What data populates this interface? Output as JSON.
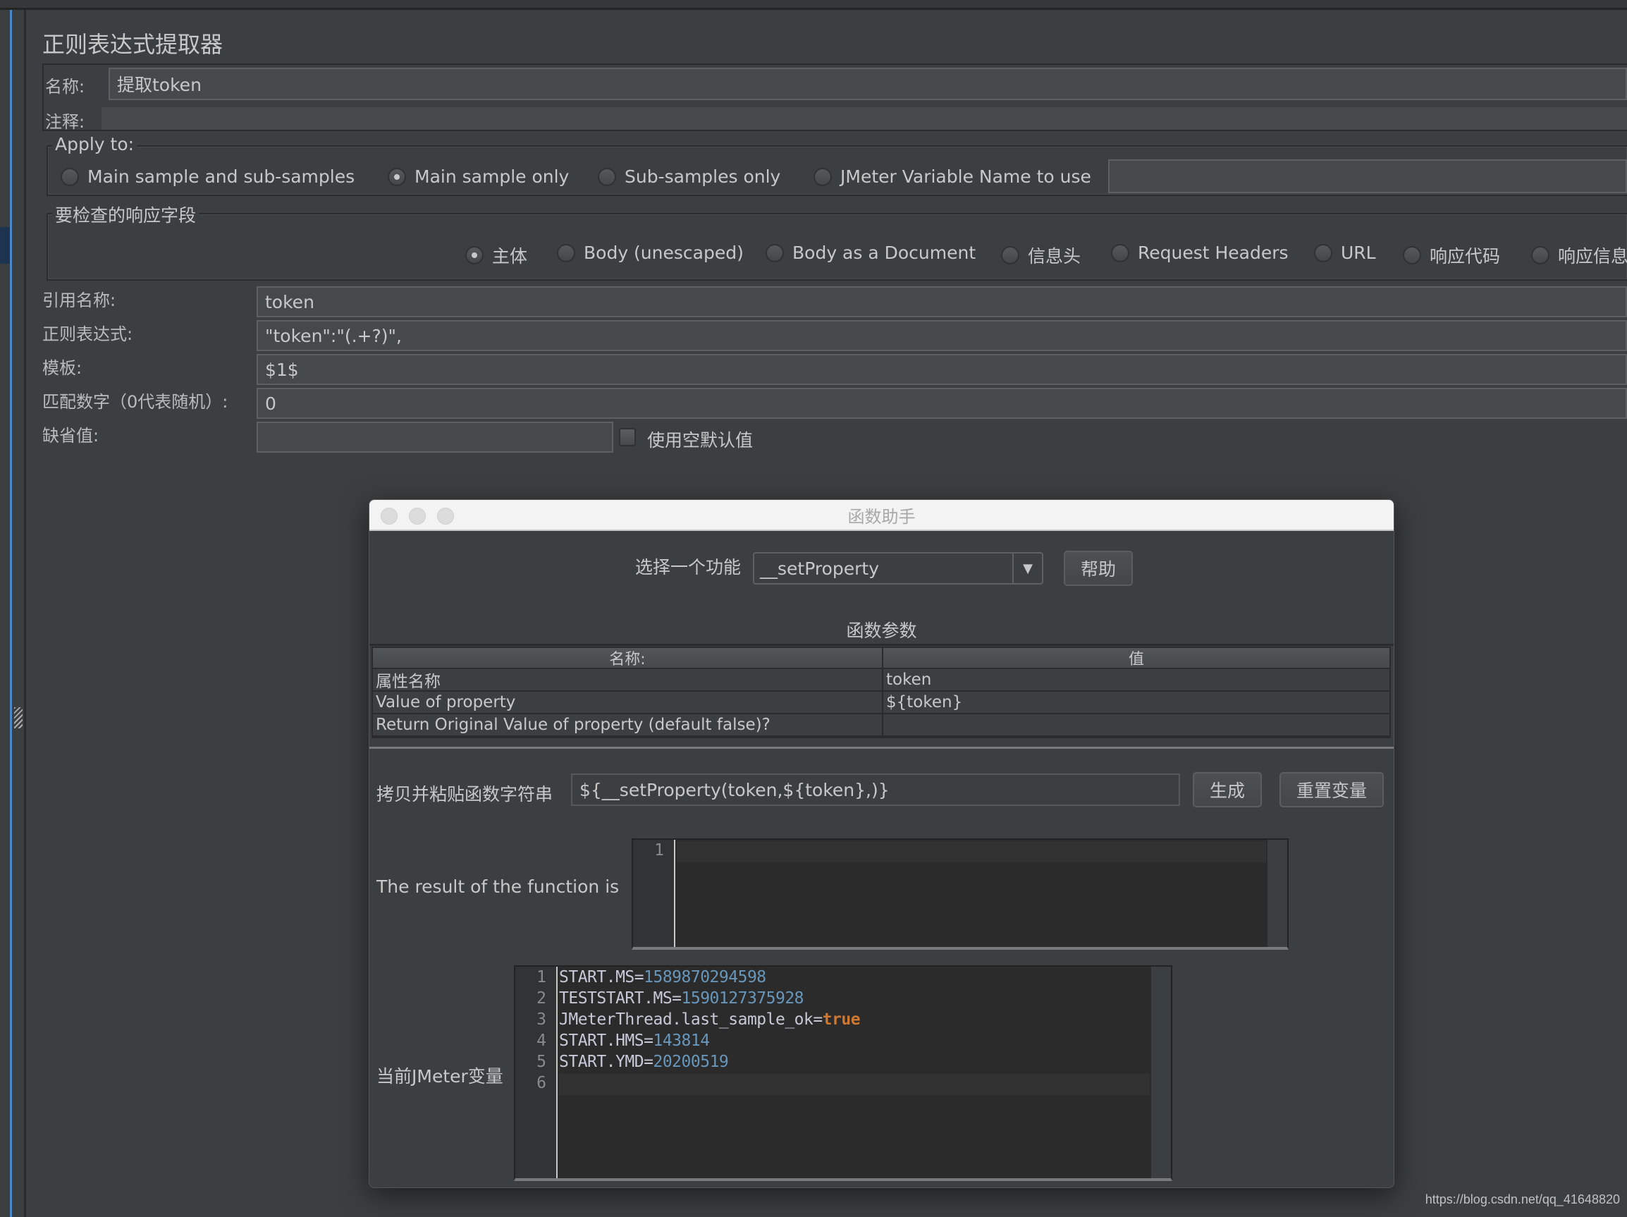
{
  "panel": {
    "title": "正则表达式提取器",
    "name_label": "名称:",
    "name_value": "提取token",
    "comment_label": "注释:",
    "comment_value": ""
  },
  "apply_to": {
    "legend": "Apply to:",
    "options": [
      {
        "label": "Main sample and sub-samples",
        "selected": false
      },
      {
        "label": "Main sample only",
        "selected": true
      },
      {
        "label": "Sub-samples only",
        "selected": false
      },
      {
        "label": "JMeter Variable Name to use",
        "selected": false
      }
    ],
    "variable_name_value": ""
  },
  "response_field": {
    "legend": "要检查的响应字段",
    "options": [
      {
        "label": "主体",
        "selected": true
      },
      {
        "label": "Body (unescaped)",
        "selected": false
      },
      {
        "label": "Body as a Document",
        "selected": false
      },
      {
        "label": "信息头",
        "selected": false
      },
      {
        "label": "Request Headers",
        "selected": false
      },
      {
        "label": "URL",
        "selected": false
      },
      {
        "label": "响应代码",
        "selected": false
      },
      {
        "label": "响应信息",
        "selected": false
      }
    ]
  },
  "form": {
    "ref_name_label": "引用名称:",
    "ref_name_value": "token",
    "regex_label": "正则表达式:",
    "regex_value": "\"token\":\"(.+?)\",",
    "template_label": "模板:",
    "template_value": "$1$",
    "match_no_label": "匹配数字（0代表随机）:",
    "match_no_value": "0",
    "default_label": "缺省值:",
    "default_value": "",
    "empty_default_label": "使用空默认值",
    "empty_default_checked": false
  },
  "dialog": {
    "title": "函数助手",
    "select_label": "选择一个功能",
    "selected_function": "__setProperty",
    "help_button": "帮助",
    "params_title": "函数参数",
    "table": {
      "columns": [
        "名称:",
        "值"
      ],
      "rows": [
        [
          "属性名称",
          "token"
        ],
        [
          "Value of property",
          "${token}"
        ],
        [
          "Return Original Value of property (default false)?",
          ""
        ]
      ]
    },
    "copy_label": "拷贝并粘贴函数字符串",
    "function_string": "${__setProperty(token,${token},)}",
    "generate_button": "生成",
    "reset_button": "重置变量",
    "result_label": "The result of the function is",
    "result_lines": [
      "1"
    ],
    "vars_label": "当前JMeter变量",
    "vars_lines": [
      {
        "n": "1",
        "key": "START.MS=",
        "val": "1589870294598",
        "type": "num"
      },
      {
        "n": "2",
        "key": "TESTSTART.MS=",
        "val": "1590127375928",
        "type": "num"
      },
      {
        "n": "3",
        "key": "JMeterThread.last_sample_ok=",
        "val": "true",
        "type": "kw"
      },
      {
        "n": "4",
        "key": "START.HMS=",
        "val": "143814",
        "type": "num"
      },
      {
        "n": "5",
        "key": "START.YMD=",
        "val": "20200519",
        "type": "num"
      },
      {
        "n": "6",
        "key": "",
        "val": "",
        "type": "num"
      }
    ]
  },
  "watermark": "https://blog.csdn.net/qq_41648820",
  "colors": {
    "background": "#3c3f41",
    "number": "#6897bb",
    "keyword": "#cc7832",
    "selection_accent": "#4b87c9"
  }
}
